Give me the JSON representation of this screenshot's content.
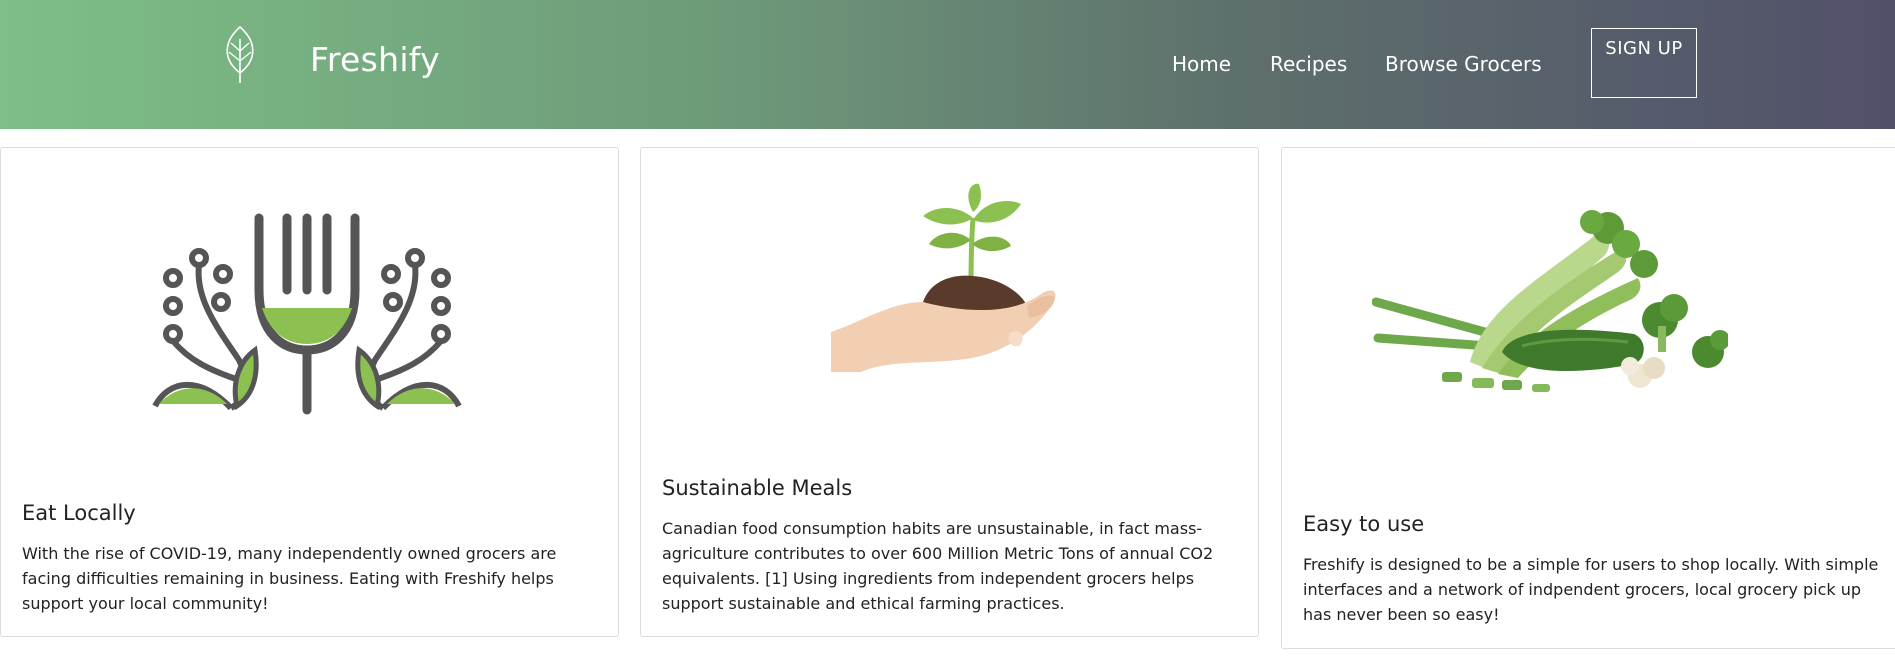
{
  "brand": {
    "name": "Freshify"
  },
  "nav": {
    "home": "Home",
    "recipes": "Recipes",
    "browse_grocers": "Browse Grocers",
    "signup": "SIGN UP"
  },
  "colors": {
    "gradient_start": "#7dbf86",
    "gradient_end": "#51506a",
    "leaf_green": "#8cc152",
    "icon_gray": "#555555"
  },
  "cards": [
    {
      "icon": "fork-leaves-icon",
      "title": "Eat Locally",
      "text": "With the rise of COVID-19, many independently owned grocers are facing difficulties remaining in business. Eating with Freshify helps support your local community!"
    },
    {
      "icon": "hand-sprout-icon",
      "title": "Sustainable Meals",
      "text": "Canadian food consumption habits are unsustainable, in fact mass-agriculture contributes to over 600 Million Metric Tons of annual CO2 equivalents. [1] Using ingredients from independent grocers helps support sustainable and ethical farming practices."
    },
    {
      "icon": "vegetables-icon",
      "title": "Easy to use",
      "text": "Freshify is designed to be a simple for users to shop locally. With simple interfaces and a network of indpendent grocers, local grocery pick up has never been so easy!"
    }
  ]
}
